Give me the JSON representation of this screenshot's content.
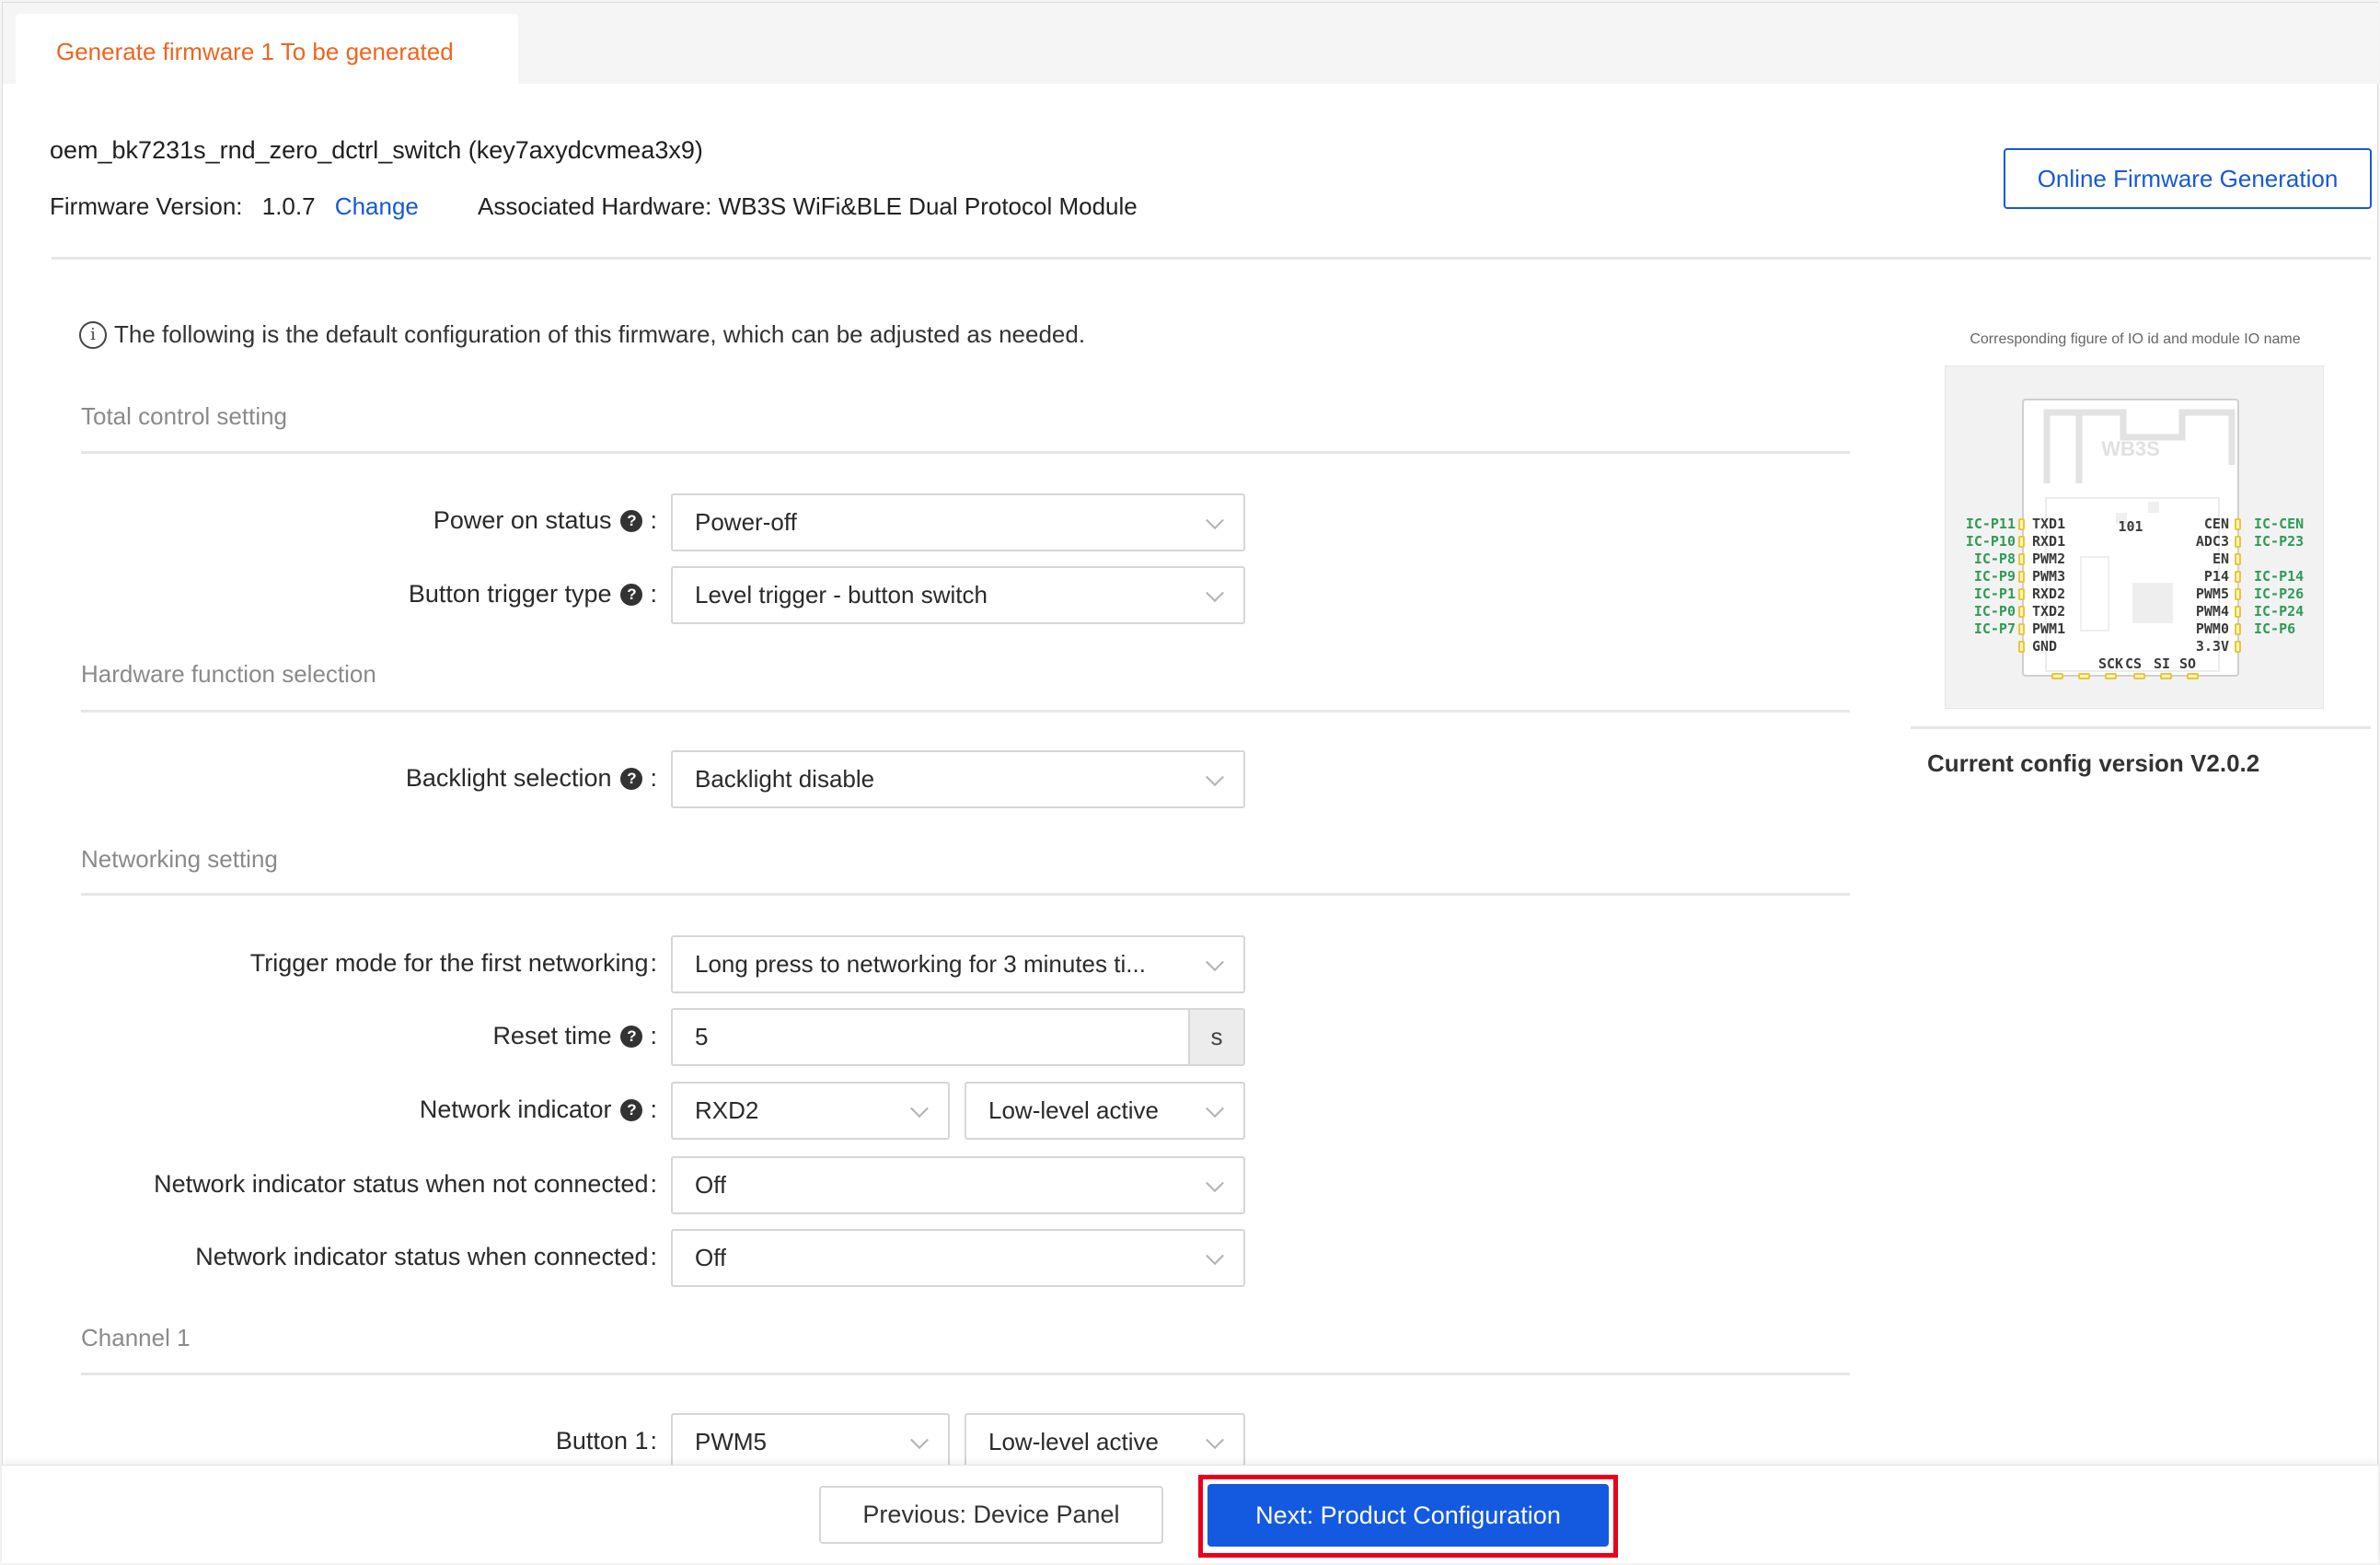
{
  "tab": {
    "label": "Generate firmware 1 To be generated",
    "color": "#f0641e"
  },
  "header": {
    "title": "oem_bk7231s_rnd_zero_dctrl_switch (key7axydcvmea3x9)",
    "firmware_version_label": "Firmware Version:",
    "firmware_version": "1.0.7",
    "change_link": "Change",
    "hardware_label": "Associated Hardware:",
    "hardware_value": "WB3S WiFi&BLE Dual Protocol Module",
    "online_generation_button": "Online Firmware Generation"
  },
  "info_text": "The following is the default configuration of this firmware, which can be adjusted as needed.",
  "sections": {
    "total_control": {
      "heading": "Total control setting",
      "power_on_status": {
        "label": "Power on status",
        "value": "Power-off"
      },
      "button_trigger_type": {
        "label": "Button trigger type",
        "value": "Level trigger - button switch"
      }
    },
    "hardware": {
      "heading": "Hardware function selection",
      "backlight_selection": {
        "label": "Backlight selection",
        "value": "Backlight disable"
      }
    },
    "networking": {
      "heading": "Networking setting",
      "trigger_mode": {
        "label": "Trigger mode for the first networking",
        "value": "Long press to networking for 3 minutes ti..."
      },
      "reset_time": {
        "label": "Reset time",
        "value": "5",
        "unit": "s"
      },
      "network_indicator": {
        "label": "Network indicator",
        "pin": "RXD2",
        "level": "Low-level active"
      },
      "status_not_connected": {
        "label": "Network indicator status when not connected",
        "value": "Off"
      },
      "status_connected": {
        "label": "Network indicator status when connected",
        "value": "Off"
      }
    },
    "channel1": {
      "heading": "Channel 1",
      "button1": {
        "label": "Button 1",
        "pin": "PWM5",
        "level": "Low-level active"
      }
    }
  },
  "colon": ":",
  "help_glyph": "?",
  "info_glyph": "i",
  "diagram": {
    "title": "Corresponding figure of IO id and module IO name",
    "module_name": "WB3S",
    "chip_code": "101",
    "left_pins": [
      {
        "ic": "IC-P11",
        "name": "TXD1"
      },
      {
        "ic": "IC-P10",
        "name": "RXD1"
      },
      {
        "ic": "IC-P8",
        "name": "PWM2"
      },
      {
        "ic": "IC-P9",
        "name": "PWM3"
      },
      {
        "ic": "IC-P1",
        "name": "RXD2"
      },
      {
        "ic": "IC-P0",
        "name": "TXD2"
      },
      {
        "ic": "IC-P7",
        "name": "PWM1"
      },
      {
        "ic": "",
        "name": "GND"
      }
    ],
    "right_pins": [
      {
        "ic": "IC-CEN",
        "name": "CEN"
      },
      {
        "ic": "IC-P23",
        "name": "ADC3"
      },
      {
        "ic": "",
        "name": "EN"
      },
      {
        "ic": "IC-P14",
        "name": "P14"
      },
      {
        "ic": "IC-P26",
        "name": "PWM5"
      },
      {
        "ic": "IC-P24",
        "name": "PWM4"
      },
      {
        "ic": "IC-P6",
        "name": "PWM0"
      },
      {
        "ic": "",
        "name": "3.3V"
      }
    ],
    "bottom_pins": [
      "SCK",
      "CS",
      "SI",
      "SO"
    ]
  },
  "config_version": "Current config version V2.0.2",
  "footer": {
    "previous_button": "Previous:  Device Panel",
    "next_button": "Next:  Product Configuration",
    "highlight_color": "#e8001c",
    "primary_color": "#145ae0"
  }
}
